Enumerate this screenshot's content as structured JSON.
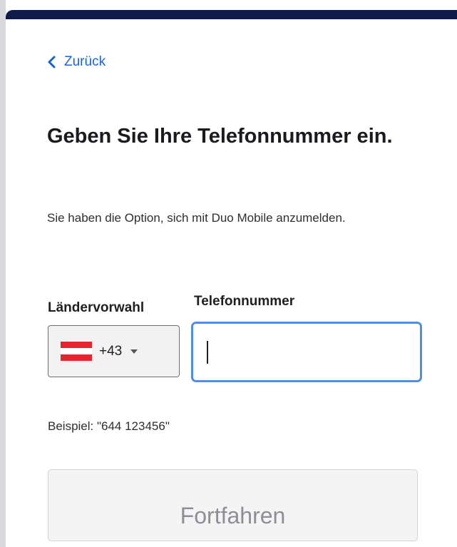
{
  "header": {
    "back_label": "Zurück"
  },
  "main": {
    "title": "Geben Sie Ihre Telefonnummer ein.",
    "subtitle": "Sie haben die Option, sich mit Duo Mobile anzumelden."
  },
  "form": {
    "country_label": "Ländervorwahl",
    "phone_label": "Telefonnummer",
    "country_code": "+43",
    "country_flag": "austria-flag-icon",
    "phone_value": "",
    "example": "Beispiel: \"644 123456\"",
    "continue_label": "Fortfahren"
  },
  "colors": {
    "top_bar": "#0d1c4d",
    "link": "#1a63d6",
    "input_focus": "#4d8ee6",
    "flag_red": "#e8232d"
  }
}
